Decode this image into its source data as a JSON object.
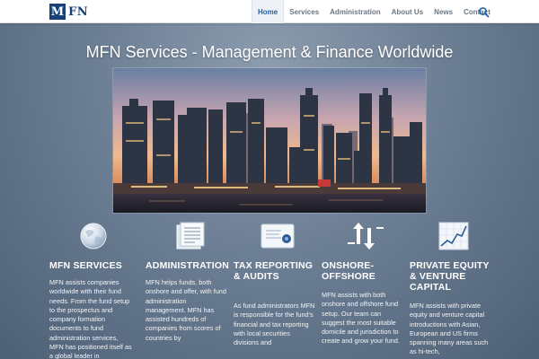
{
  "header": {
    "logo_letter": "M",
    "logo_text": "FN",
    "nav": [
      {
        "label": "Home",
        "active": true
      },
      {
        "label": "Services",
        "active": false
      },
      {
        "label": "Administration",
        "active": false
      },
      {
        "label": "About Us",
        "active": false
      },
      {
        "label": "News",
        "active": false
      },
      {
        "label": "Contact",
        "active": false
      }
    ],
    "search_icon": "search-icon"
  },
  "hero": {
    "title": "MFN Services - Management & Finance Worldwide",
    "image": "city-skyline-photo"
  },
  "services": [
    {
      "icon": "globe-icon",
      "title": "MFN SERVICES",
      "text": "MFN assists companies worldwide with their fund needs. From the fund setup to the prospectus and company formation documents to fund administration services, MFN has positioned itself as a global leader in"
    },
    {
      "icon": "documents-icon",
      "title": "ADMINISTRATION",
      "text": "MFN helps funds, both onshore and offer, with fund administration management. MFN has assisted hundreds of companies from scores of countries by"
    },
    {
      "icon": "certificate-icon",
      "title": "TAX REPORTING & AUDITS",
      "text": "As fund administrators MFN is responsible for the fund's financial and tax reporting with local securities divisions and"
    },
    {
      "icon": "exchange-arrows-icon",
      "title": "ONSHORE-OFFSHORE",
      "text": "MFN assists with both onshore and offshore fund setup. Our team can suggest the most suitable domicile and jurisdiction to create and grow your fund."
    },
    {
      "icon": "growth-chart-icon",
      "title": "PRIVATE EQUITY & VENTURE CAPITAL",
      "text": "MFN assists with private equity and venture capital introductions with Asian, European and US firms spanning many areas such as hi-tech,"
    }
  ]
}
